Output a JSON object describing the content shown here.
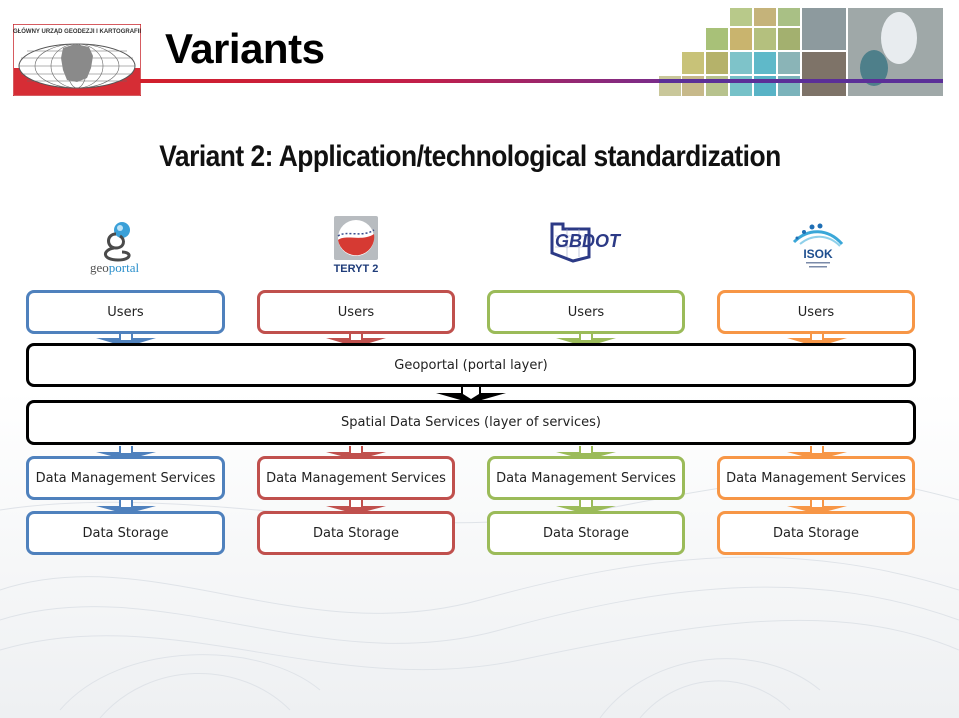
{
  "header": {
    "title": "Variants",
    "org_logo_text": "GŁÓWNY URZĄD GEODEZJI I KARTOGRAFII"
  },
  "slide": {
    "subtitle": "Variant 2: Application/technological standardization"
  },
  "brands": [
    {
      "name": "geoportal",
      "label_a": "geo",
      "label_b": "portal"
    },
    {
      "name": "teryt2",
      "label": "TERYT 2"
    },
    {
      "name": "gbdot",
      "label": "GBDOT"
    },
    {
      "name": "isok",
      "label": "ISOK"
    }
  ],
  "colors": {
    "blue": "#4f81bd",
    "red": "#c0504d",
    "green": "#9bbb59",
    "orange": "#f79646",
    "black": "#000000"
  },
  "diagram": {
    "users_label": "Users",
    "columns": [
      {
        "users": "Users",
        "dms": "Data Management Services",
        "storage": "Data Storage"
      },
      {
        "users": "Users",
        "dms": "Data Management Services",
        "storage": "Data Storage"
      },
      {
        "users": "Users",
        "dms": "Data Management Services",
        "storage": "Data Storage"
      },
      {
        "users": "Users",
        "dms": "Data Management Services",
        "storage": "Data Storage"
      }
    ],
    "geoportal_layer": "Geoportal (portal layer)",
    "services_layer": "Spatial Data Services (layer of services)"
  }
}
